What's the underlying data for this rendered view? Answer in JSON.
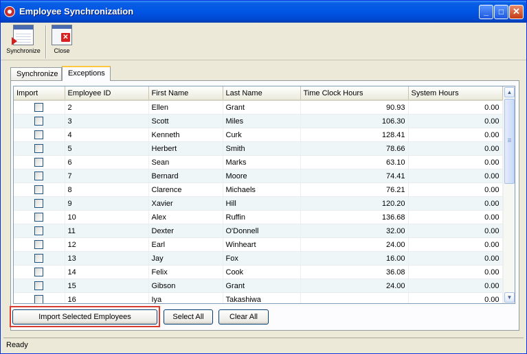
{
  "window": {
    "title": "Employee Synchronization",
    "accent": "#0055e5"
  },
  "titlebar_buttons": {
    "minimize": "_",
    "maximize": "□",
    "close": "✕"
  },
  "toolbar": {
    "synchronize_label": "Synchronize",
    "close_label": "Close"
  },
  "tabs": [
    {
      "label": "Synchronize"
    },
    {
      "label": "Exceptions"
    }
  ],
  "grid": {
    "columns": [
      "Import",
      "Employee ID",
      "First Name",
      "Last Name",
      "Time Clock Hours",
      "System Hours"
    ],
    "rows": [
      {
        "id": "2",
        "first": "Ellen",
        "last": "Grant",
        "tch": "90.93",
        "sys": "0.00"
      },
      {
        "id": "3",
        "first": "Scott",
        "last": "Miles",
        "tch": "106.30",
        "sys": "0.00"
      },
      {
        "id": "4",
        "first": "Kenneth",
        "last": "Curk",
        "tch": "128.41",
        "sys": "0.00"
      },
      {
        "id": "5",
        "first": "Herbert",
        "last": "Smith",
        "tch": "78.66",
        "sys": "0.00"
      },
      {
        "id": "6",
        "first": "Sean",
        "last": "Marks",
        "tch": "63.10",
        "sys": "0.00"
      },
      {
        "id": "7",
        "first": "Bernard",
        "last": "Moore",
        "tch": "74.41",
        "sys": "0.00"
      },
      {
        "id": "8",
        "first": "Clarence",
        "last": "Michaels",
        "tch": "76.21",
        "sys": "0.00"
      },
      {
        "id": "9",
        "first": "Xavier",
        "last": "Hill",
        "tch": "120.20",
        "sys": "0.00"
      },
      {
        "id": "10",
        "first": "Alex",
        "last": "Ruffin",
        "tch": "136.68",
        "sys": "0.00"
      },
      {
        "id": "11",
        "first": "Dexter",
        "last": "O'Donnell",
        "tch": "32.00",
        "sys": "0.00"
      },
      {
        "id": "12",
        "first": "Earl",
        "last": "Winheart",
        "tch": "24.00",
        "sys": "0.00"
      },
      {
        "id": "13",
        "first": "Jay",
        "last": "Fox",
        "tch": "16.00",
        "sys": "0.00"
      },
      {
        "id": "14",
        "first": "Felix",
        "last": "Cook",
        "tch": "36.08",
        "sys": "0.00"
      },
      {
        "id": "15",
        "first": "Gibson",
        "last": "Grant",
        "tch": "24.00",
        "sys": "0.00"
      },
      {
        "id": "16",
        "first": "Iya",
        "last": "Takashiwa",
        "tch": "",
        "sys": "0.00"
      }
    ]
  },
  "buttons": {
    "import": "Import Selected Employees",
    "select_all": "Select All",
    "clear_all": "Clear All"
  },
  "status": {
    "text": "Ready"
  }
}
